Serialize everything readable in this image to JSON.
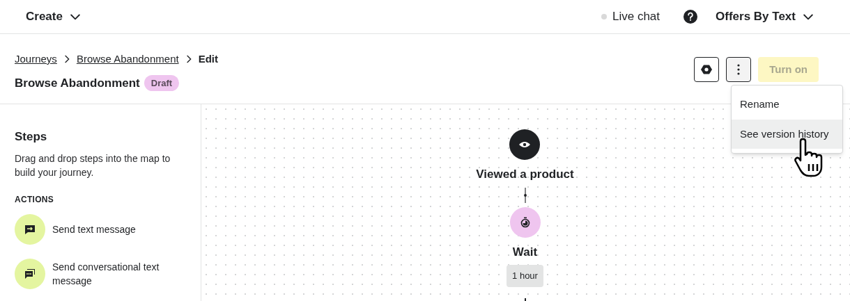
{
  "header": {
    "create_menu": "Create",
    "live_chat": "Live chat",
    "account_menu": "Offers By Text"
  },
  "breadcrumbs": [
    {
      "label": "Journeys",
      "kind": "link"
    },
    {
      "label": "Browse Abandonment",
      "kind": "link"
    },
    {
      "label": "Edit",
      "kind": "current"
    }
  ],
  "title": "Browse Abandonment",
  "status_badge": "Draft",
  "turn_on_button": {
    "label": "Turn on",
    "disabled": true
  },
  "more_menu": {
    "expanded": true,
    "items": [
      {
        "label": "Rename",
        "selected": false
      },
      {
        "label": "See version history",
        "selected": true
      }
    ]
  },
  "steps_panel": {
    "title": "Steps",
    "description": "Drag and drop steps into the map to build your journey.",
    "section": "ACTIONS",
    "actions": [
      {
        "label": "Send text message",
        "kind": "text"
      },
      {
        "label": "Send conversational text message",
        "kind": "conversational"
      }
    ]
  },
  "journey_nodes": [
    {
      "kind": "trigger",
      "label": "Viewed a product"
    },
    {
      "kind": "wait",
      "label": "Wait",
      "duration": "1 hour"
    }
  ]
}
